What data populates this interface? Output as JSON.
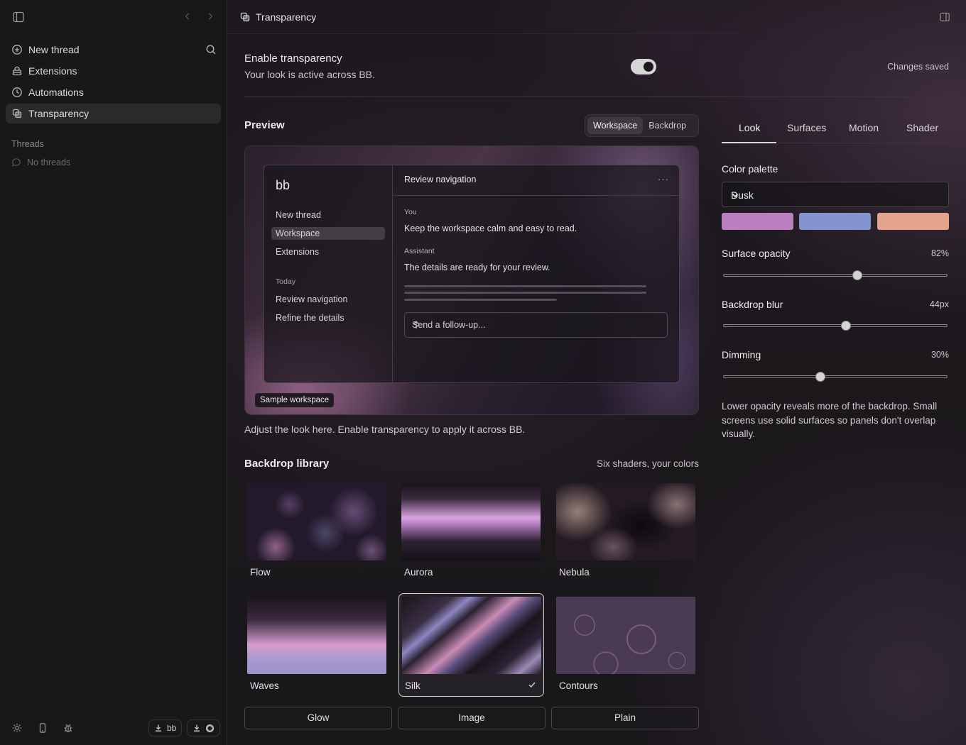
{
  "sidebar": {
    "items": [
      {
        "label": "New thread"
      },
      {
        "label": "Extensions"
      },
      {
        "label": "Automations"
      },
      {
        "label": "Transparency"
      }
    ],
    "threads_label": "Threads",
    "threads_empty": "No threads",
    "bottom": {
      "pill1_label": "bb"
    }
  },
  "header": {
    "title": "Transparency"
  },
  "enable": {
    "title": "Enable transparency",
    "subtitle": "Your look is active across BB.",
    "status": "Changes saved",
    "enabled": true
  },
  "preview": {
    "label": "Preview",
    "segments": [
      "Workspace",
      "Backdrop"
    ],
    "selected_segment": "Workspace",
    "window": {
      "brand": "bb",
      "nav": [
        "New thread",
        "Workspace",
        "Extensions"
      ],
      "today_label": "Today",
      "recent": [
        "Review navigation",
        "Refine the details"
      ],
      "title": "Review navigation",
      "more": "···",
      "you_label": "You",
      "you_msg": "Keep the workspace calm and easy to read.",
      "assistant_label": "Assistant",
      "assistant_msg": "The details are ready for your review.",
      "input_placeholder": "Send a follow-up..."
    },
    "badge": "Sample workspace",
    "caption": "Adjust the look here. Enable transparency to apply it across BB."
  },
  "library": {
    "label": "Backdrop library",
    "subtitle": "Six shaders, your colors",
    "cards": [
      {
        "name": "Flow"
      },
      {
        "name": "Aurora"
      },
      {
        "name": "Nebula"
      },
      {
        "name": "Waves"
      },
      {
        "name": "Silk"
      },
      {
        "name": "Contours"
      }
    ],
    "selected": "Silk",
    "modes": [
      "Glow",
      "Image",
      "Plain"
    ]
  },
  "panel": {
    "tabs": [
      "Look",
      "Surfaces",
      "Motion",
      "Shader"
    ],
    "selected_tab": "Look",
    "palette_label": "Color palette",
    "palette_value": "Dusk",
    "swatches": [
      "#bb7fbf",
      "#8494d0",
      "#e4a48c"
    ],
    "opacity_label": "Surface opacity",
    "opacity_value": "82%",
    "opacity_fraction": 0.6,
    "blur_label": "Backdrop blur",
    "blur_value": "44px",
    "blur_fraction": 0.55,
    "dimming_label": "Dimming",
    "dimming_value": "30%",
    "dimming_fraction": 0.43,
    "note": "Lower opacity reveals more of the backdrop. Small screens use solid surfaces so panels don't overlap visually."
  }
}
